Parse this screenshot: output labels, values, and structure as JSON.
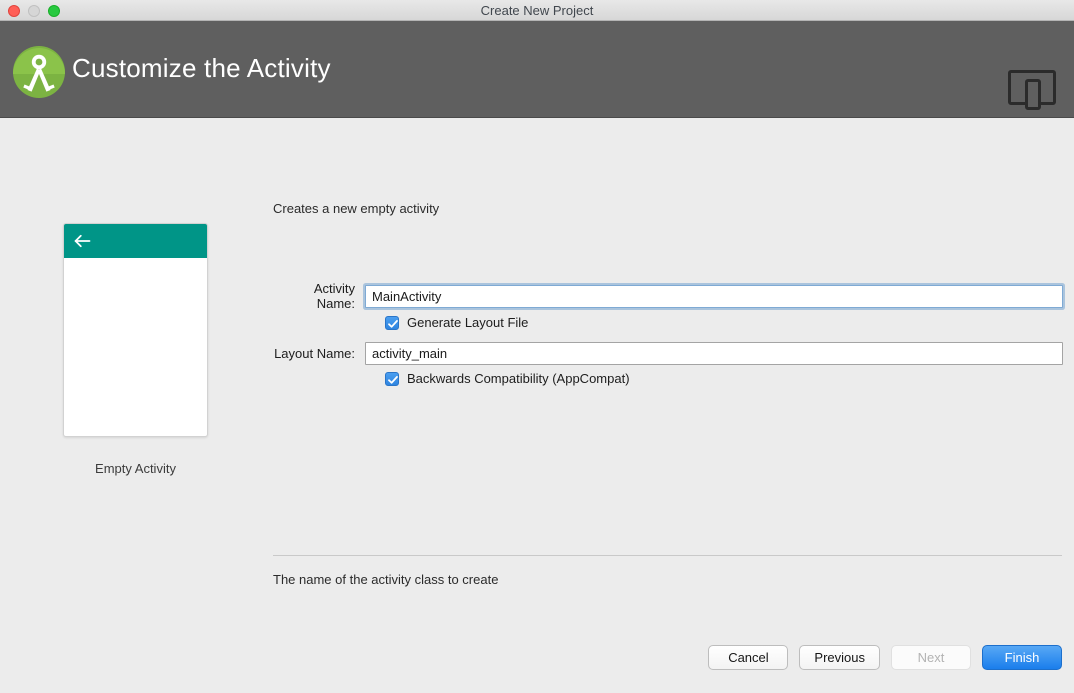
{
  "window": {
    "title": "Create New Project",
    "traffic_lights": [
      "close-button",
      "minimize-button",
      "zoom-button"
    ]
  },
  "header": {
    "title": "Customize the Activity",
    "logo_icon": "android-studio-logo-icon",
    "device_icon": "tablet-phone-device-icon",
    "background_color": "#5f5f5f"
  },
  "preview": {
    "label": "Empty Activity",
    "appbar_color": "#009587",
    "back_icon": "arrow-left-icon"
  },
  "form": {
    "description": "Creates a new empty activity",
    "activity_name": {
      "label": "Activity Name:",
      "value": "MainActivity",
      "placeholder": "",
      "focused": true
    },
    "generate_layout": {
      "label": "Generate Layout File",
      "checked": true
    },
    "layout_name": {
      "label": "Layout Name:",
      "value": "activity_main",
      "placeholder": "",
      "focused": false
    },
    "backwards_compatibility": {
      "label": "Backwards Compatibility (AppCompat)",
      "checked": true
    },
    "hint": "The name of the activity class to create"
  },
  "footer": {
    "buttons": [
      {
        "label": "Cancel",
        "state": "enabled"
      },
      {
        "label": "Previous",
        "state": "enabled"
      },
      {
        "label": "Next",
        "state": "disabled"
      },
      {
        "label": "Finish",
        "state": "primary"
      }
    ]
  },
  "colors": {
    "accent_blue": "#1a7eec",
    "teal": "#009587",
    "body_background": "#ececec",
    "header_background": "#5f5f5f"
  }
}
